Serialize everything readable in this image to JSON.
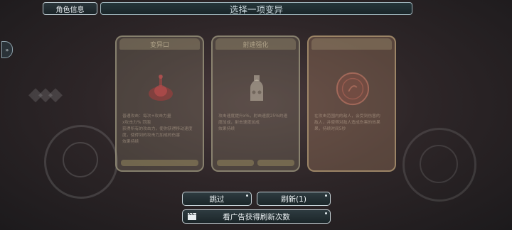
{
  "header": {
    "role_info_label": "角色信息",
    "title": "选择一项变异"
  },
  "cards": [
    {
      "name": "变异口",
      "lines": [
        "普通攻击：每次+攻击力量",
        "x攻击力% 范围",
        "获得所有的攻击力，使你获得移动速度",
        "度，使得到的攻击力加成的伤害",
        "效果持续"
      ]
    },
    {
      "name": "射速强化",
      "lines": [
        "攻击速度提升x%，射击速度25%的速",
        "度加成，射击速度加成",
        "效果持续"
      ]
    },
    {
      "name": "",
      "lines": [
        "在攻击范围内的敌人，会受到伤害的",
        "敌人，并使得对敌人造成伤害的效果",
        "果，持续时间5秒"
      ]
    }
  ],
  "buttons": {
    "skip": "跳过",
    "refresh": "刷新(1)",
    "watch_ad": "看广告获得刷新次数"
  },
  "icons": {
    "side_tab": "double-chevron-right-icon",
    "ad": "video-clapper-icon"
  }
}
